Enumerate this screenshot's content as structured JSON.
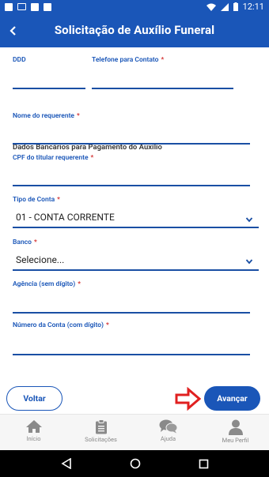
{
  "status_bar": {
    "time": "12:11"
  },
  "header": {
    "title": "Solicitação de Auxílio Funeral"
  },
  "form": {
    "ddd_label": "DDD",
    "telefone_label": "Telefone para Contato",
    "required_mark": "*",
    "section_title": "Dados Bancários para Pagamento do Auxílio",
    "nome_label": "Nome do requerente",
    "cpf_label": "CPF do titular requerente",
    "tipo_conta_label": "Tipo de Conta",
    "tipo_conta_value": "01 - CONTA CORRENTE",
    "banco_label": "Banco",
    "banco_value": "Selecione...",
    "agencia_label": "Agência (sem dígito)",
    "conta_label": "Número da Conta (com dígito)"
  },
  "buttons": {
    "voltar": "Voltar",
    "avancar": "Avançar"
  },
  "bottom_nav": [
    {
      "label": "Início",
      "icon": "home-icon"
    },
    {
      "label": "Solicitações",
      "icon": "clipboard-icon"
    },
    {
      "label": "Ajuda",
      "icon": "chat-bubbles-icon"
    },
    {
      "label": "Meu Perfil",
      "icon": "person-icon"
    }
  ],
  "colors": {
    "primary": "#1a56b8",
    "required": "#d32f2f",
    "annotation_arrow": "#e02020"
  }
}
